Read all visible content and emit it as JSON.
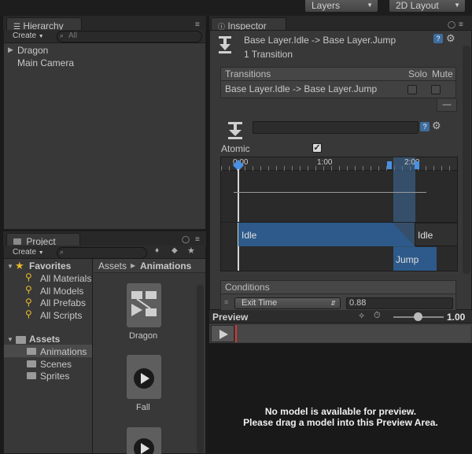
{
  "topbar": {
    "layers_label": "Layers",
    "layout_label": "2D Layout"
  },
  "hierarchy": {
    "tab": "Hierarchy",
    "create_label": "Create",
    "search_placeholder": "All",
    "items": [
      "Dragon",
      "Main Camera"
    ]
  },
  "project": {
    "tab": "Project",
    "create_label": "Create",
    "favorites_label": "Favorites",
    "favorites": [
      "All Materials",
      "All Models",
      "All Prefabs",
      "All Scripts"
    ],
    "assets_label": "Assets",
    "folders": [
      "Animations",
      "Scenes",
      "Sprites"
    ],
    "breadcrumb": [
      "Assets",
      "Animations"
    ],
    "assets": [
      "Dragon",
      "Fall"
    ]
  },
  "inspector": {
    "tab": "Inspector",
    "title": "Base Layer.Idle -> Base Layer.Jump",
    "subtitle": "1 Transition",
    "transitions_header": "Transitions",
    "solo_label": "Solo",
    "mute_label": "Mute",
    "transition_row": "Base Layer.Idle -> Base Layer.Jump",
    "minus_label": "—",
    "atomic_label": "Atomic",
    "atomic_checked": "✓",
    "timeline_ticks": [
      "0:00",
      "1:00",
      "2:00"
    ],
    "idle_a": "Idle",
    "idle_b": "Idle",
    "jump": "Jump",
    "conditions_header": "Conditions",
    "condition_param": "Exit Time",
    "condition_value": "0.88"
  },
  "preview": {
    "title": "Preview",
    "speed": "1.00",
    "message_line1": "No model is available for preview.",
    "message_line2": "Please drag a model into this Preview Area."
  },
  "colors": {
    "accent_blue": "#2d5a8a",
    "panel": "#383838",
    "selection": "#3e6d9f"
  }
}
